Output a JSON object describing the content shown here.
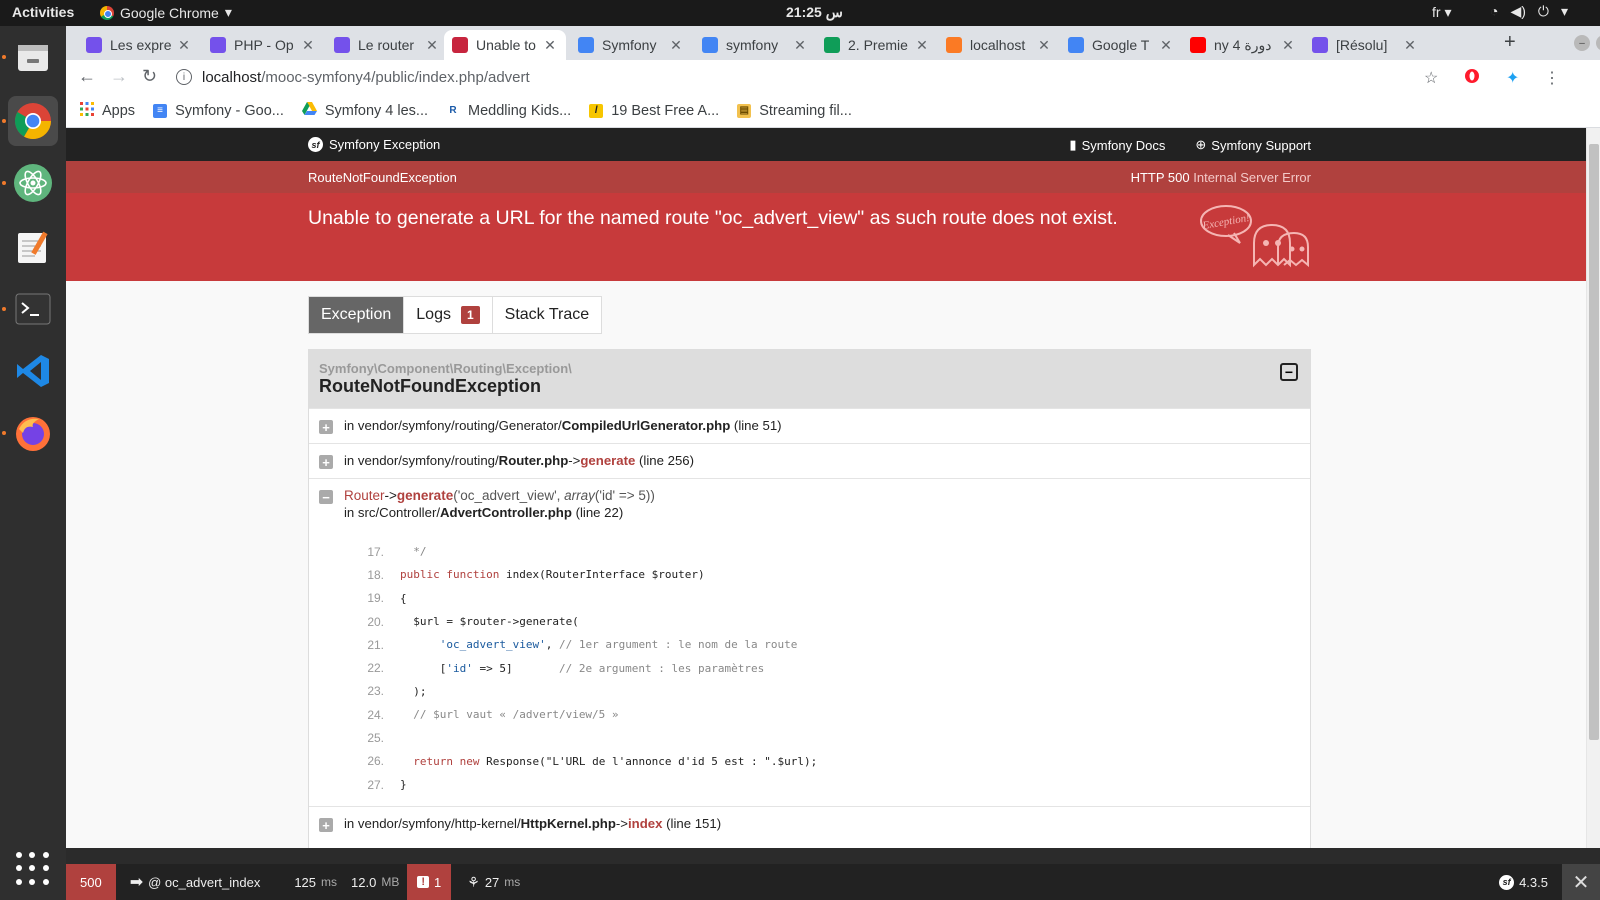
{
  "os": {
    "activities": "Activities",
    "app_name": "Google Chrome",
    "clock": "21:25 س",
    "lang": "fr"
  },
  "browser": {
    "tabs": [
      {
        "title": "Les expre",
        "favicon": "openclassrooms",
        "color": "#7451eb"
      },
      {
        "title": "PHP - Op",
        "favicon": "openclassrooms",
        "color": "#7451eb"
      },
      {
        "title": "Le router",
        "favicon": "openclassrooms",
        "color": "#7451eb"
      },
      {
        "title": "Unable to",
        "favicon": "symfony-ghost",
        "color": "#c7253e",
        "active": true
      },
      {
        "title": "Symfony",
        "favicon": "docs",
        "color": "#4285f4"
      },
      {
        "title": "symfony",
        "favicon": "docs",
        "color": "#4285f4"
      },
      {
        "title": "2. Premie",
        "favicon": "drive",
        "color": "#0f9d58"
      },
      {
        "title": "localhost",
        "favicon": "xampp",
        "color": "#fb7a24"
      },
      {
        "title": "Google T",
        "favicon": "translate",
        "color": "#4285f4"
      },
      {
        "title": "ny 4 دورة",
        "favicon": "youtube",
        "color": "#ff0000"
      },
      {
        "title": "[Résolu]",
        "favicon": "openclassrooms",
        "color": "#7451eb"
      }
    ],
    "url_host": "localhost",
    "url_path": "/mooc-symfony4/public/index.php/advert",
    "bookmarks": [
      {
        "label": "Apps",
        "icon": "apps-grid-icon"
      },
      {
        "label": "Symfony - Goo...",
        "icon": "docs-icon"
      },
      {
        "label": "Symfony 4 les...",
        "icon": "drive-icon"
      },
      {
        "label": "Meddling Kids...",
        "icon": "r-icon"
      },
      {
        "label": "19 Best Free A...",
        "icon": "l-icon"
      },
      {
        "label": "Streaming fil...",
        "icon": "folder-icon"
      }
    ]
  },
  "page": {
    "header_logo": "Symfony Exception",
    "docs_link": "Symfony Docs",
    "support_link": "Symfony Support",
    "exception_class": "RouteNotFoundException",
    "http_code": "HTTP 500",
    "http_text": "Internal Server Error",
    "message": "Unable to generate a URL for the named route \"oc_advert_view\" as such route does not exist.",
    "ghost_text": "Exception!",
    "tabs": {
      "exception": "Exception",
      "logs": "Logs",
      "logs_count": "1",
      "stack": "Stack Trace"
    },
    "trace_namespace": "Symfony\\Component\\Routing\\Exception\\",
    "trace_class": "RouteNotFoundException",
    "frames": [
      {
        "toggle": "+",
        "prefix": "in vendor/symfony/routing/Generator/",
        "file": "CompiledUrlGenerator.php",
        "method": "",
        "line": "(line 51)"
      },
      {
        "toggle": "+",
        "prefix": "in vendor/symfony/routing/",
        "file": "Router.php",
        "method": "generate",
        "line": "(line 256)"
      },
      {
        "toggle": "−",
        "call_class": "Router",
        "call_method": "generate",
        "call_args": "('oc_advert_view', ",
        "call_args_type": "array",
        "call_args_rest": "('id' => 5))",
        "prefix": "in src/Controller/",
        "file": "AdvertController.php",
        "line": "(line 22)"
      },
      {
        "toggle": "+",
        "prefix": "in vendor/symfony/http-kernel/",
        "file": "HttpKernel.php",
        "method": "index",
        "line": "(line 151)"
      }
    ],
    "code": [
      {
        "no": "17.",
        "text": "  */"
      },
      {
        "no": "18.",
        "text": "public function index(RouterInterface $router)"
      },
      {
        "no": "19.",
        "text": "{"
      },
      {
        "no": "20.",
        "text": "  $url = $router->generate("
      },
      {
        "no": "21.",
        "text": "      'oc_advert_view', // 1er argument : le nom de la route"
      },
      {
        "no": "22.",
        "text": "      ['id' => 5]       // 2e argument : les paramètres"
      },
      {
        "no": "23.",
        "text": "  );"
      },
      {
        "no": "24.",
        "text": "  // $url vaut « /advert/view/5 »"
      },
      {
        "no": "25.",
        "text": ""
      },
      {
        "no": "26.",
        "text": "  return new Response(\"L'URL de l'annonce d'id 5 est : \".$url);"
      },
      {
        "no": "27.",
        "text": "}"
      }
    ]
  },
  "debug_bar": {
    "status": "500",
    "route": "@ oc_advert_index",
    "time": "125",
    "time_unit": "ms",
    "memory": "12.0",
    "memory_unit": "MB",
    "errors": "1",
    "twig_time": "27",
    "twig_unit": "ms",
    "version": "4.3.5"
  }
}
